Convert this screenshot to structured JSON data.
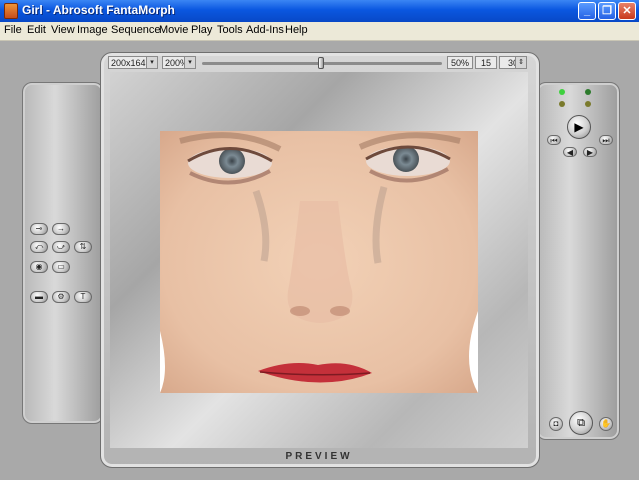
{
  "window": {
    "title": "Girl - Abrosoft FantaMorph"
  },
  "menu": [
    "File",
    "Edit",
    "View",
    "Image",
    "Sequence",
    "Movie",
    "Play",
    "Tools",
    "Add-Ins",
    "Help"
  ],
  "toolbar": {
    "size": "200x164",
    "zoom": "200%",
    "percent": "50%",
    "frames": "15",
    "fps": "30"
  },
  "preview": {
    "label": "PREVIEW"
  },
  "icons": [
    "app-icon",
    "minimize-icon",
    "maximize-icon",
    "close-icon",
    "play-icon",
    "rewind-icon",
    "forward-icon",
    "camera-icon"
  ]
}
